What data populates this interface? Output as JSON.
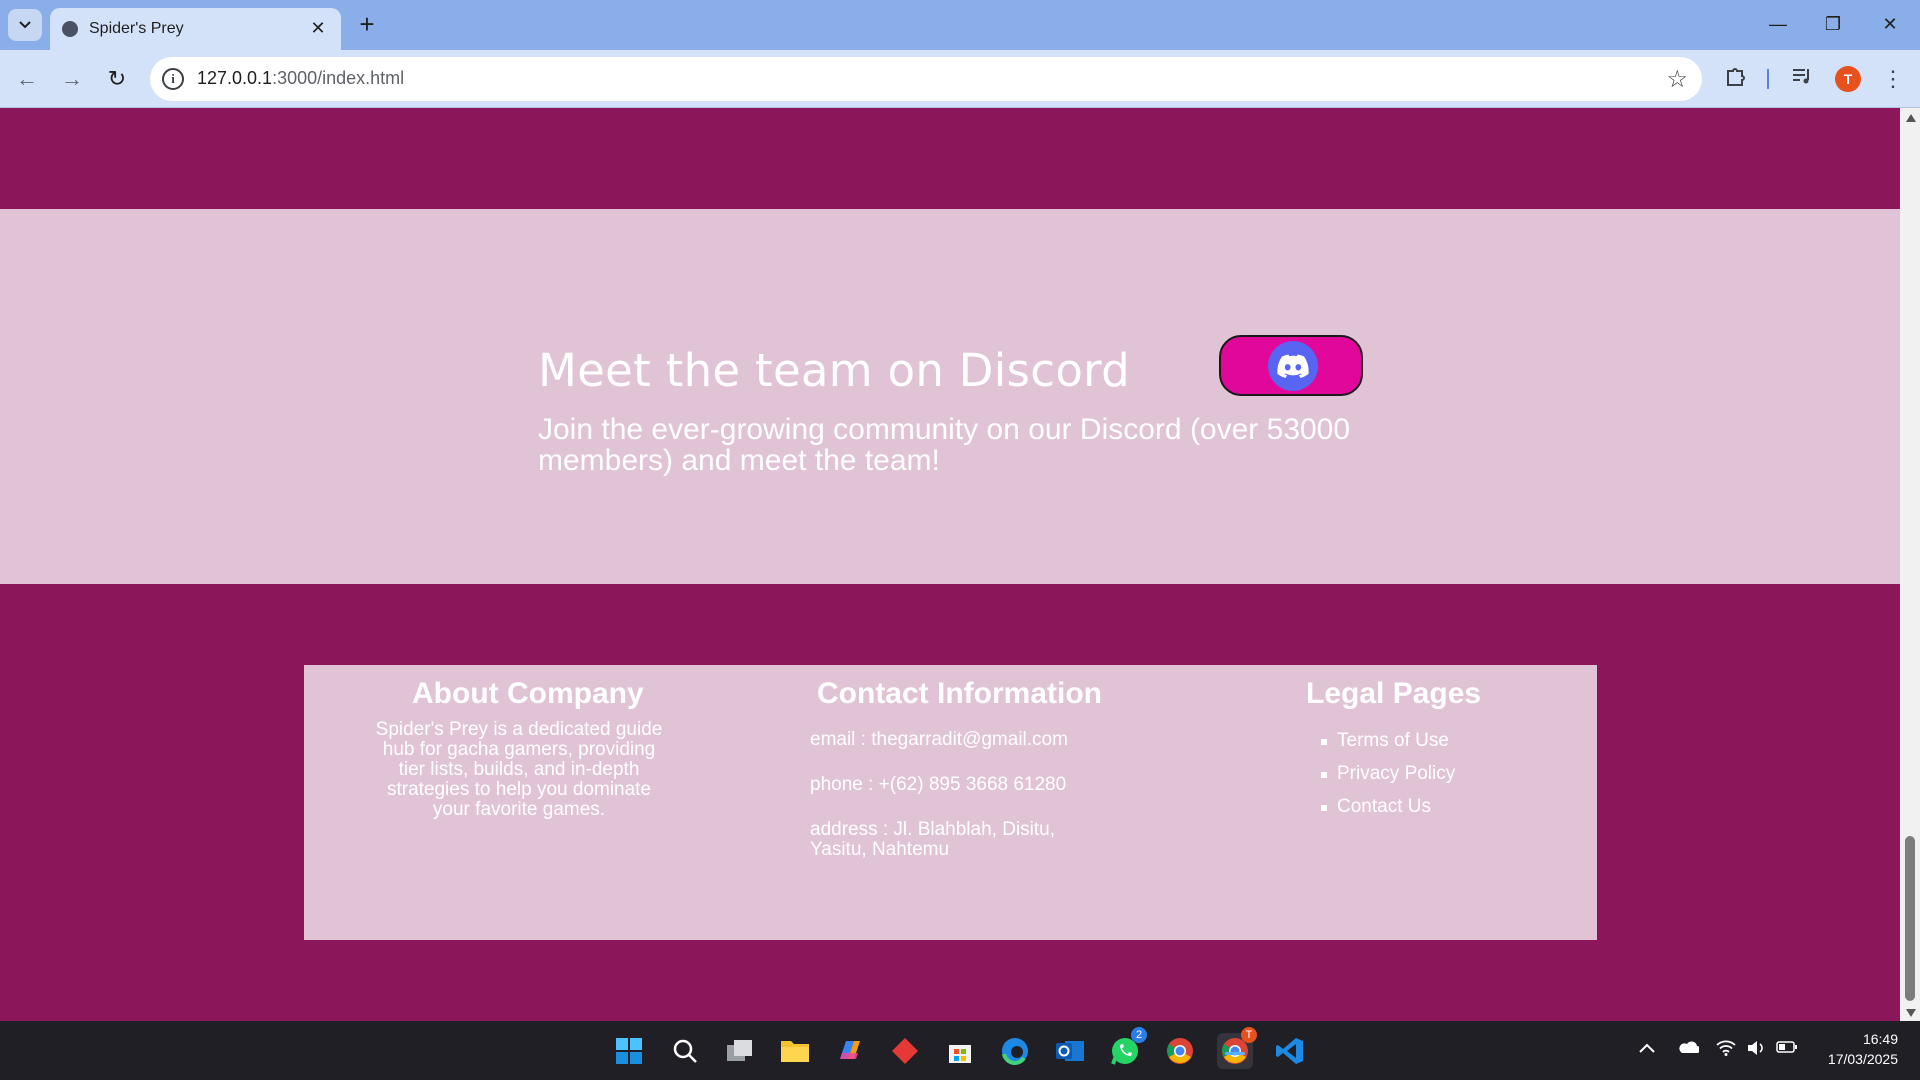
{
  "browser": {
    "tab_title": "Spider's Prey",
    "close_tab": "✕",
    "new_tab": "+",
    "url_host": "127.0.0.1",
    "url_rest": ":3000/index.html",
    "profile_initial": "T",
    "window": {
      "minimize": "—",
      "restore": "❐",
      "close": "✕"
    },
    "nav": {
      "back": "←",
      "forward": "→",
      "reload": "↻"
    }
  },
  "discord": {
    "heading": "Meet the team on Discord",
    "text": "Join the ever-growing community on our Discord (over 53000 members) and meet the team!"
  },
  "footer": {
    "about": {
      "title": "About Company",
      "text": "Spider's Prey is a dedicated guide hub for gacha gamers, providing tier lists, builds, and in-depth strategies to help you dominate your favorite games."
    },
    "contact": {
      "title": "Contact Information",
      "email": "email : thegarradit@gmail.com",
      "phone": "phone : +(62) 895 3668 61280",
      "address": "address : Jl. Blahblah, Disitu, Yasitu, Nahtemu"
    },
    "legal": {
      "title": "Legal Pages",
      "links": [
        "Terms of Use",
        "Privacy Policy",
        "Contact Us"
      ]
    }
  },
  "taskbar": {
    "whatsapp_badge": "2",
    "chrome_badge": "T",
    "time": "16:49",
    "date": "17/03/2025"
  },
  "colors": {
    "page_bg": "#8b1659",
    "section_bg": "#e1c3d6",
    "discord_button": "#e0079a",
    "discord_brand": "#5865f2"
  }
}
